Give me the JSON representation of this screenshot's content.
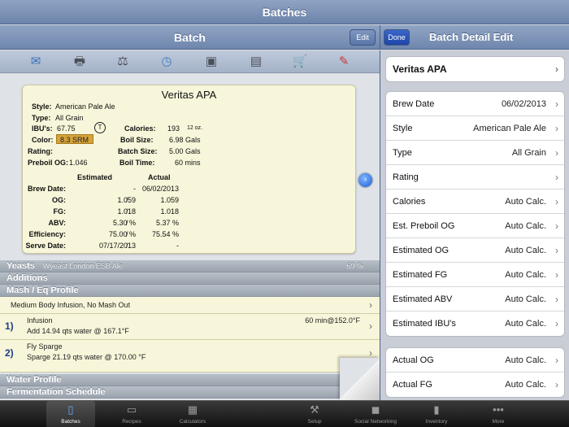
{
  "app": {
    "title": "Batches"
  },
  "left_nav": {
    "title": "Batch",
    "edit_label": "Edit"
  },
  "right_nav": {
    "done_label": "Done",
    "title": "Batch Detail Edit"
  },
  "toolbar_icons": [
    "mail-icon",
    "print-icon",
    "scale-icon",
    "timer-icon",
    "camera-icon",
    "document-icon",
    "cart-icon",
    "clipboard-icon"
  ],
  "card": {
    "title": "Veritas APA",
    "style_label": "Style:",
    "style": "American Pale Ale",
    "type_label": "Type:",
    "type": "All Grain",
    "ibu_label": "IBU's:",
    "ibu": "67.75",
    "tinseth_mark": "T",
    "color_label": "Color:",
    "color": "8.3 SRM",
    "rating_label": "Rating:",
    "preboil_label": "Preboil OG:",
    "preboil": "1.046",
    "calories_label": "Calories:",
    "calories": "193",
    "calories_unit": "12 oz.",
    "boil_size_label": "Boil Size:",
    "boil_size": "6.98 Gals",
    "batch_size_label": "Batch Size:",
    "batch_size": "5.00 Gals",
    "boil_time_label": "Boil Time:",
    "boil_time": "60 mins",
    "estimated_header": "Estimated",
    "actual_header": "Actual",
    "stats": [
      {
        "label": "Brew Date:",
        "est": "-",
        "sep": "",
        "act": "06/02/2013"
      },
      {
        "label": "OG:",
        "est": "1.059",
        "sep": "/",
        "act": "1.059"
      },
      {
        "label": "FG:",
        "est": "1.018",
        "sep": "/",
        "act": "1.018"
      },
      {
        "label": "ABV:",
        "est": "5.30 %",
        "sep": "/",
        "act": "5.37 %"
      },
      {
        "label": "Efficiency:",
        "est": "75.00 %",
        "sep": "/",
        "act": "75.54 %"
      },
      {
        "label": "Serve Date:",
        "est": "07/17/2013",
        "sep": "/",
        "act": "-"
      }
    ]
  },
  "sections": {
    "yeasts": "Yeasts",
    "yeasts_ghost": "Wyeast London ESB Ale",
    "yeasts_ghost_pct": "69 %",
    "additions": "Additions",
    "mash": "Mash / Eq Profile",
    "water": "Water Profile",
    "fermentation": "Fermentation Schedule"
  },
  "mash_profile": "Medium Body Infusion, No Mash Out",
  "mash_steps": [
    {
      "num": "1)",
      "name": "Infusion",
      "detail": "Add 14.94 qts water @ 167.1°F",
      "time": "60 min@152.0°F"
    },
    {
      "num": "2)",
      "name": "Fly Sparge",
      "detail": "Sparge 21.19 qts water @ 170.00 °F",
      "time": ""
    }
  ],
  "right_panel": {
    "name": "Veritas APA",
    "group1": [
      {
        "label": "Brew Date",
        "value": "06/02/2013"
      },
      {
        "label": "Style",
        "value": "American Pale Ale"
      },
      {
        "label": "Type",
        "value": "All Grain"
      },
      {
        "label": "Rating",
        "value": ""
      },
      {
        "label": "Calories",
        "value": "Auto Calc."
      },
      {
        "label": "Est. Preboil OG",
        "value": "Auto Calc."
      },
      {
        "label": "Estimated OG",
        "value": "Auto Calc."
      },
      {
        "label": "Estimated FG",
        "value": "Auto Calc."
      },
      {
        "label": "Estimated ABV",
        "value": "Auto Calc."
      },
      {
        "label": "Estimated IBU's",
        "value": "Auto Calc."
      }
    ],
    "group2": [
      {
        "label": "Actual OG",
        "value": "Auto Calc."
      },
      {
        "label": "Actual FG",
        "value": "Auto Calc."
      }
    ]
  },
  "tabs": [
    {
      "label": "Batches",
      "icon": "beer-glass-icon",
      "active": true
    },
    {
      "label": "Recipes",
      "icon": "recipes-icon",
      "active": false
    },
    {
      "label": "Calculators",
      "icon": "calculator-icon",
      "active": false
    },
    {
      "label": "Setup",
      "icon": "tools-icon",
      "active": false
    },
    {
      "label": "Social Networking",
      "icon": "chat-bubble-icon",
      "active": false
    },
    {
      "label": "Inventory",
      "icon": "bar-chart-icon",
      "active": false
    },
    {
      "label": "More",
      "icon": "more-dots-icon",
      "active": false
    }
  ]
}
